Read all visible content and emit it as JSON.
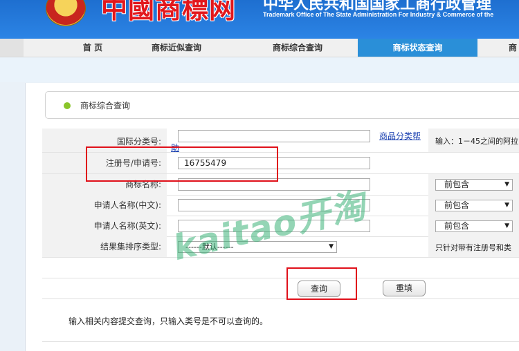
{
  "header": {
    "site_logo": "中國商標网",
    "org_cn": "中华人民共和国国家工商行政管理",
    "org_en": "Trademark Office of The State Administration For Industry & Commerce of the"
  },
  "nav": {
    "home": "首 页",
    "similar": "商标近似查询",
    "comprehensive": "商标综合查询",
    "status": "商标状态查询",
    "overflow": "商"
  },
  "section": {
    "title": "商标综合查询"
  },
  "form": {
    "intl_class_label": "国际分类号:",
    "goods_class_help_link": "商品分类帮",
    "goods_class_help_link_tail": "助",
    "intl_class_hint": "输入：1－45之间的阿拉",
    "reg_no_label": "注册号/申请号:",
    "reg_no_value": "16755479",
    "mark_name_label": "商标名称:",
    "applicant_cn_label": "申请人名称(中文):",
    "applicant_en_label": "申请人名称(英文):",
    "match_option": "前包含",
    "sort_label": "结果集排序类型:",
    "sort_value": "------默认------",
    "sort_hint": "只针对带有注册号和类"
  },
  "buttons": {
    "query": "查询",
    "reset": "重填"
  },
  "note": "输入相关内容提交查询，只输入类号是不可以查询的。",
  "watermark": "kaitao开淘",
  "colors": {
    "nav_active": "#2a8fd8",
    "highlight": "#e0101a",
    "watermark": "#3cb278"
  }
}
